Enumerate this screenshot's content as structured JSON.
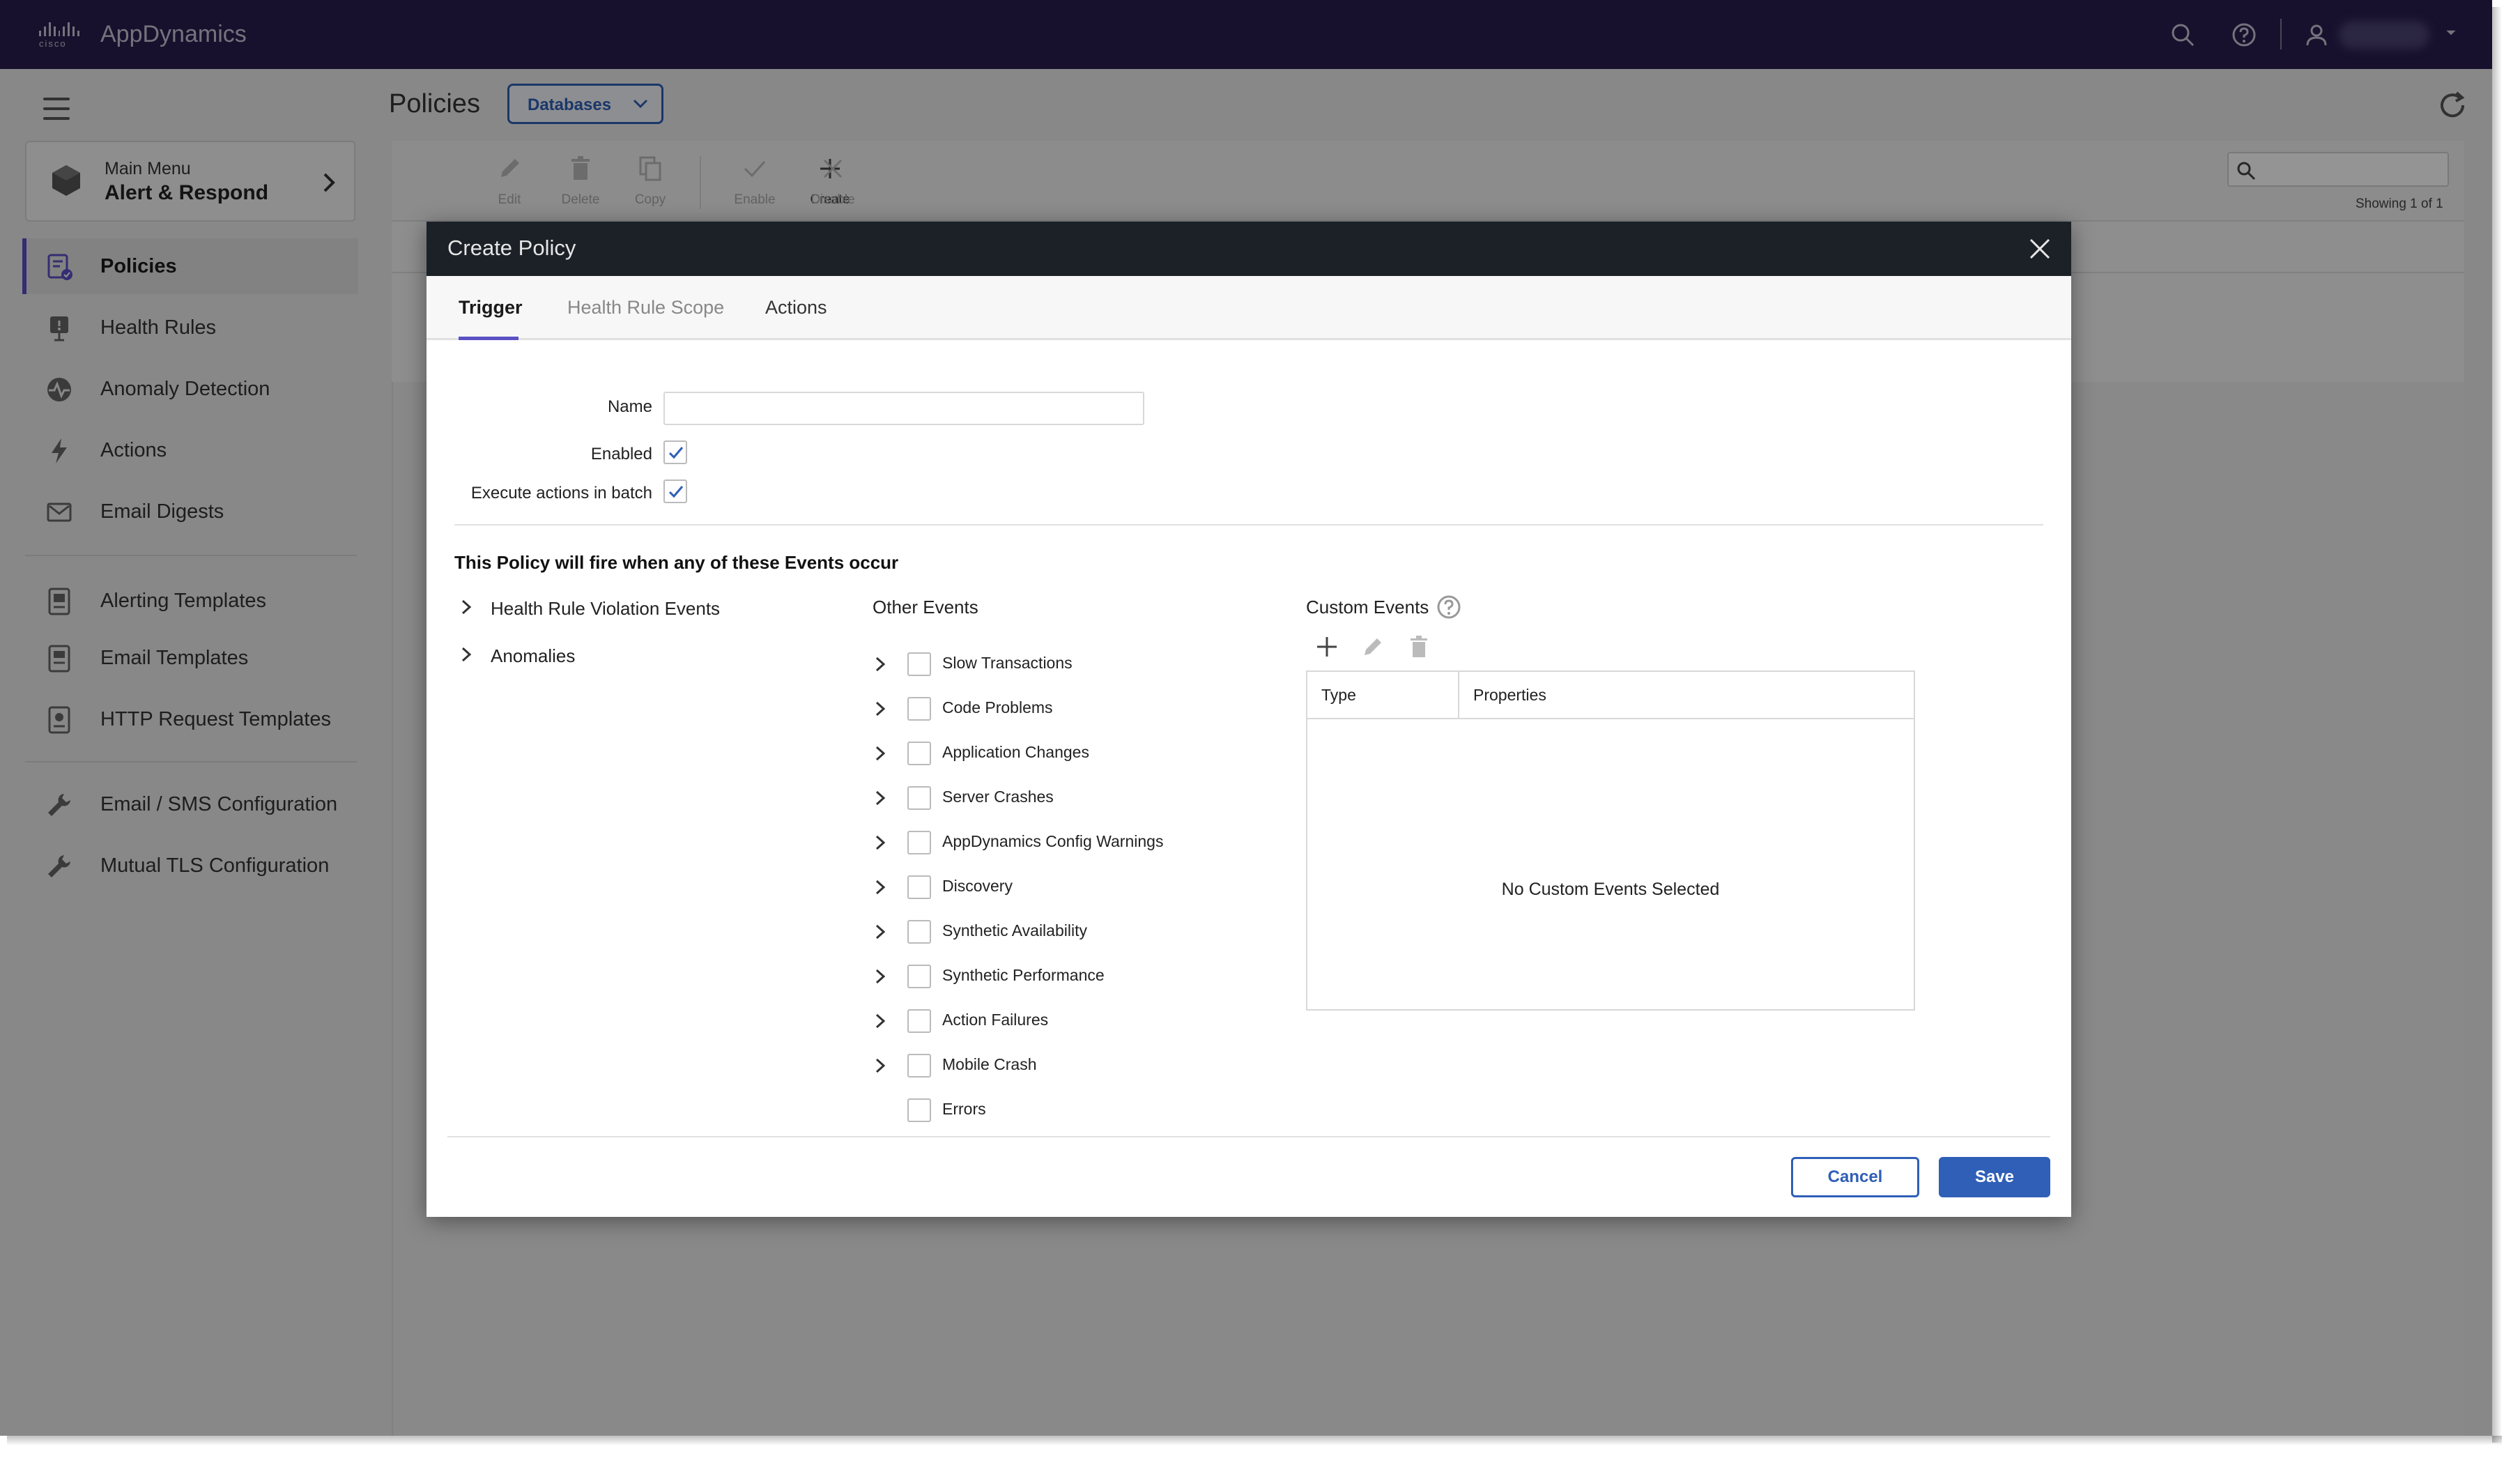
{
  "app": {
    "brand_mark": "cisco",
    "name": "AppDynamics"
  },
  "sidebar": {
    "main_menu_label": "Main Menu",
    "main_menu_value": "Alert & Respond",
    "items": [
      {
        "label": "Policies",
        "icon": "policy-icon",
        "active": true
      },
      {
        "label": "Health Rules",
        "icon": "health-rule-icon"
      },
      {
        "label": "Anomaly Detection",
        "icon": "anomaly-icon"
      },
      {
        "label": "Actions",
        "icon": "lightning-icon"
      },
      {
        "label": "Email Digests",
        "icon": "email-digest-icon"
      },
      {
        "label": "Alerting Templates",
        "icon": "template-icon"
      },
      {
        "label": "Email Templates",
        "icon": "email-template-icon"
      },
      {
        "label": "HTTP Request Templates",
        "icon": "http-template-icon"
      },
      {
        "label": "Email / SMS Configuration",
        "icon": "wrench-icon"
      },
      {
        "label": "Mutual TLS Configuration",
        "icon": "wrench-icon"
      }
    ]
  },
  "main": {
    "title": "Policies",
    "scope_dropdown": "Databases",
    "toolbar": {
      "create": "Create",
      "edit": "Edit",
      "delete": "Delete",
      "copy": "Copy",
      "enable": "Enable",
      "disable": "Disable"
    },
    "showing": "Showing 1 of 1"
  },
  "modal": {
    "title": "Create Policy",
    "tabs": [
      "Trigger",
      "Health Rule Scope",
      "Actions"
    ],
    "name_label": "Name",
    "name_value": "",
    "enabled_label": "Enabled",
    "enabled": true,
    "batch_label": "Execute actions in batch",
    "batch": true,
    "section_title": "This Policy will fire when any of these Events occur",
    "left_tree": [
      "Health Rule Violation Events",
      "Anomalies"
    ],
    "other_events_title": "Other Events",
    "other_events": [
      "Slow Transactions",
      "Code Problems",
      "Application Changes",
      "Server Crashes",
      "AppDynamics Config Warnings",
      "Discovery",
      "Synthetic Availability",
      "Synthetic Performance",
      "Action Failures",
      "Mobile Crash",
      "Errors"
    ],
    "custom_events_title": "Custom Events",
    "custom_table": {
      "col_type": "Type",
      "col_properties": "Properties",
      "empty": "No Custom Events Selected"
    },
    "cancel": "Cancel",
    "save": "Save"
  },
  "colors": {
    "topbar": "#291e4f",
    "accent": "#5b4fc4",
    "primary_button": "#2f5fb7",
    "modal_header": "#1b2127"
  }
}
